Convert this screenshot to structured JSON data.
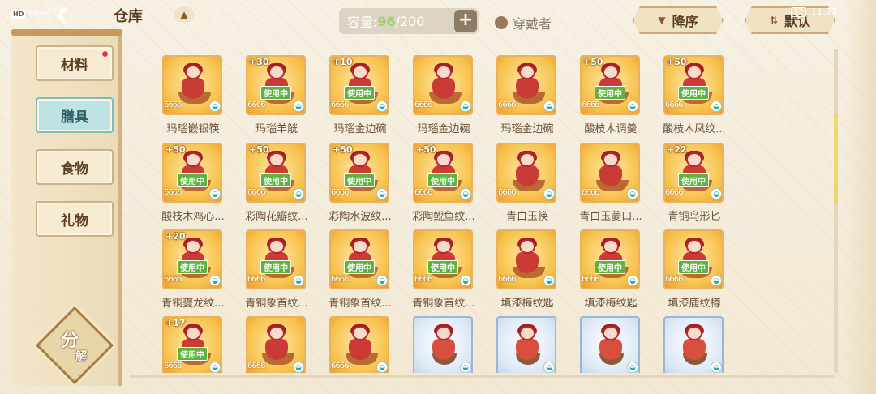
{
  "status": {
    "hd": "HD",
    "signal_left": "46",
    "signal_right": "46",
    "speed": "13.8\nK/s",
    "battery": "57",
    "time": "11:23"
  },
  "header": {
    "title": "仓库",
    "capacity_label": "容量:",
    "capacity_used": "96",
    "capacity_max": "/200",
    "capacity_add": "+",
    "wearer_label": "穿戴者",
    "sort_desc": "降序",
    "sort_default": "默认"
  },
  "tabs": [
    {
      "label": "材料",
      "active": false,
      "badge": true
    },
    {
      "label": "膳具",
      "active": true,
      "badge": false
    },
    {
      "label": "食物",
      "active": false,
      "badge": false
    },
    {
      "label": "礼物",
      "active": false,
      "badge": false
    }
  ],
  "decompose": {
    "a": "分",
    "b": "解"
  },
  "in_use_label": "使用中",
  "items": [
    {
      "name": "玛瑙嵌银筷",
      "plus": "",
      "in_use": false,
      "style": "gold"
    },
    {
      "name": "玛瑙羊觥",
      "plus": "+30",
      "in_use": true,
      "style": "gold"
    },
    {
      "name": "玛瑙金边碗",
      "plus": "+10",
      "in_use": true,
      "style": "gold"
    },
    {
      "name": "玛瑙金边碗",
      "plus": "",
      "in_use": false,
      "style": "gold"
    },
    {
      "name": "玛瑙金边碗",
      "plus": "",
      "in_use": false,
      "style": "gold"
    },
    {
      "name": "酸枝木调羹",
      "plus": "+50",
      "in_use": true,
      "style": "gold"
    },
    {
      "name": "酸枝木凤纹...",
      "plus": "+50",
      "in_use": true,
      "style": "gold"
    },
    {
      "name": "酸枝木鸡心...",
      "plus": "+50",
      "in_use": true,
      "style": "gold"
    },
    {
      "name": "彩陶花瓣纹...",
      "plus": "+50",
      "in_use": true,
      "style": "gold"
    },
    {
      "name": "彩陶水波纹...",
      "plus": "+50",
      "in_use": true,
      "style": "gold"
    },
    {
      "name": "彩陶鲵鱼纹...",
      "plus": "+50",
      "in_use": true,
      "style": "gold"
    },
    {
      "name": "青白玉筷",
      "plus": "",
      "in_use": false,
      "style": "gold"
    },
    {
      "name": "青白玉菱口...",
      "plus": "",
      "in_use": false,
      "style": "gold"
    },
    {
      "name": "青铜鸟形匕",
      "plus": "+22",
      "in_use": true,
      "style": "gold"
    },
    {
      "name": "青铜夔龙纹...",
      "plus": "+20",
      "in_use": true,
      "style": "gold"
    },
    {
      "name": "青铜象首纹...",
      "plus": "",
      "in_use": true,
      "style": "gold"
    },
    {
      "name": "青铜象首纹...",
      "plus": "",
      "in_use": true,
      "style": "gold"
    },
    {
      "name": "青铜象首纹...",
      "plus": "",
      "in_use": true,
      "style": "gold"
    },
    {
      "name": "填漆梅纹匙",
      "plus": "",
      "in_use": false,
      "style": "gold"
    },
    {
      "name": "填漆梅纹匙",
      "plus": "",
      "in_use": true,
      "style": "gold"
    },
    {
      "name": "填漆鹿纹樽",
      "plus": "",
      "in_use": true,
      "style": "gold"
    },
    {
      "name": "",
      "plus": "+17",
      "in_use": true,
      "style": "gold"
    },
    {
      "name": "",
      "plus": "",
      "in_use": false,
      "style": "gold"
    },
    {
      "name": "",
      "plus": "",
      "in_use": false,
      "style": "gold"
    },
    {
      "name": "",
      "plus": "",
      "in_use": false,
      "style": "blue"
    },
    {
      "name": "",
      "plus": "",
      "in_use": false,
      "style": "blue"
    },
    {
      "name": "",
      "plus": "",
      "in_use": false,
      "style": "blue"
    },
    {
      "name": "",
      "plus": "",
      "in_use": false,
      "style": "blue"
    }
  ],
  "stars_text": "6666",
  "colors": {
    "accent_green": "#9bd26b",
    "active_tab": "#bfe3e3",
    "gold_card": "#f7c04a"
  }
}
